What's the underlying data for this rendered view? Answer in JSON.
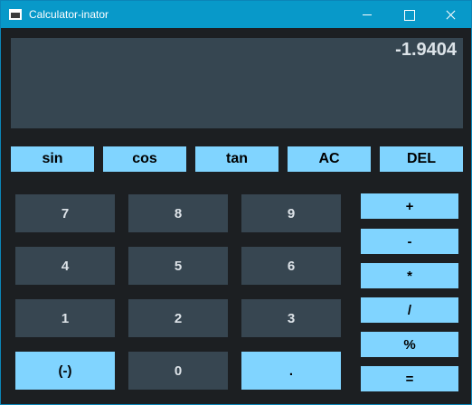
{
  "window": {
    "title": "Calculator-inator"
  },
  "display": {
    "value": "-1.9404"
  },
  "functions": [
    "sin",
    "cos",
    "tan",
    "AC",
    "DEL"
  ],
  "numpad": [
    "7",
    "8",
    "9",
    "4",
    "5",
    "6",
    "1",
    "2",
    "3",
    "(-)",
    "0",
    "."
  ],
  "operators": [
    "+",
    "-",
    "*",
    "/",
    "%",
    "="
  ],
  "colors": {
    "accent": "#80d4ff",
    "key": "#374651",
    "background": "#1c1f22",
    "titlebar": "#0899c9"
  }
}
